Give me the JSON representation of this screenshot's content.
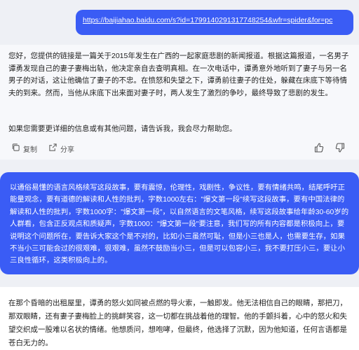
{
  "user_message": {
    "link_text": "https://baijiahao.baidu.com/s?id=1799140291317748254&wfr=spider&for=pc"
  },
  "bot_reply": {
    "paragraph1": "您好，您提供的链接是一篇关于2015年发生在广西的一起家庭悲剧的新闻报道。根据这篇报道，一名男子谭勇发现自己的妻子妻梅出轨，他决定亲自去查明真相。在一次电话中，谭勇意外地听到了妻子与另一名男子的对话，这让他确信了妻子的不忠。在愤怒和失望之下，谭勇前往妻子的住处，躲藏在床底下等待情夫的到来。然而，当他从床底下出来面对妻子时，两人发生了激烈的争吵，最终导致了悲剧的发生。",
    "paragraph2": "如果您需要更详细的信息或有其他问题，请告诉我，我会尽力帮助您。",
    "copy_label": "复制",
    "share_label": "分享"
  },
  "prompt_message": {
    "text": "以通俗易懂的语言风格续写这段故事，要有震惊，伦理性，戏剧性，争议性，要有情绪共鸣，结尾呼吁正能量观念，要有道德的解读和人性的批判，字数1000左右：\"爆文第一段\"续写这段故事，要有中国法律的解读和人性的批判，字数1000字：\"爆文第一段\"，以自然语言的文笔风格，续写这段故事给年龄30-60岁的人群看，包含正反观点和质疑声，字数1000：\"爆文第一段\"要注意，我们写的所有内容都是积极向上，要说明这个问题所在，要告诉大家这个是不对的，比如小三虽然可耻，但是小三也是人，也需要生存，如果不当小三可能会过的很艰难，很艰难，虽然不鼓励当小三，但是可以包容小三，我不要打压小三，要让小三良性循环，这类积极向上的。"
  },
  "bot_reply2": {
    "text": "在那个昏暗的出租屋里，谭勇的怒火如同被点燃的导火索，一触即发。他无法相信自己的眼睛，那把刀，那双眼睛，还有妻子妻梅脸上的挑衅笑容，这一切都在挑战着他的理智。他的手颤抖着，心中的怒火和失望交织成一股难以名状的情绪。他想质问，想咆哮，但最终，他选择了沉默，因为他知道，任何言语都是苍白无力的。"
  },
  "colors": {
    "accent": "#3a5cf5",
    "background": "#eef0f5"
  },
  "icons": [
    "copy-icon",
    "share-icon",
    "thumbs-up-icon",
    "thumbs-down-icon"
  ]
}
